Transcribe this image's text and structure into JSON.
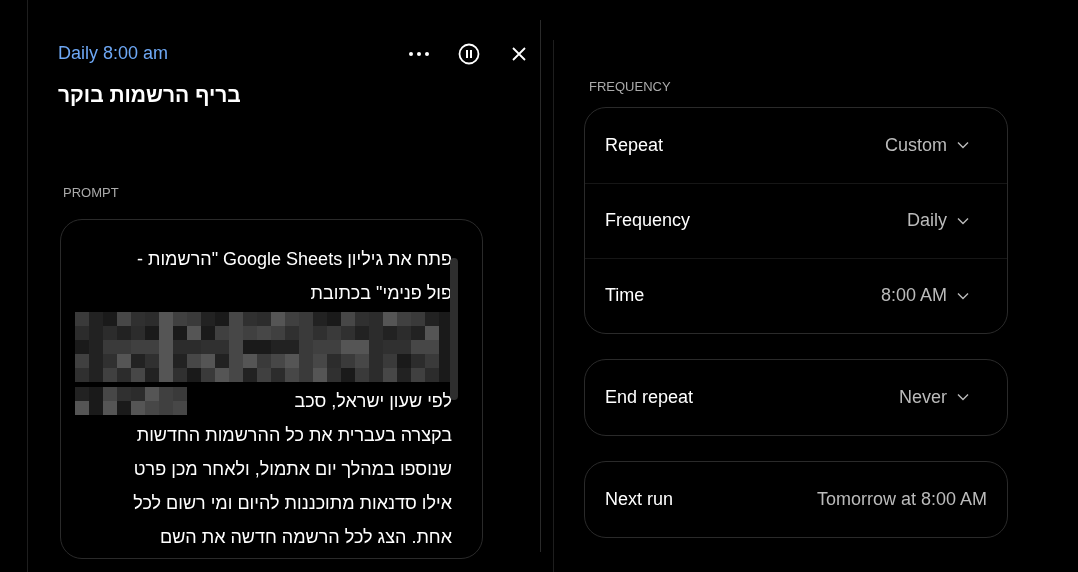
{
  "header": {
    "schedule": "Daily 8:00 am",
    "title": "בריף הרשמות בוקר"
  },
  "prompt": {
    "label": "PROMPT",
    "lines": [
      {
        "kind": "text",
        "text": "פתח את גיליון Google Sheets \"הרשמות -"
      },
      {
        "kind": "text",
        "text": "פול פנימי\" בכתובת"
      },
      {
        "kind": "redacted"
      },
      {
        "kind": "text_redacted",
        "text": "לפי שעון ישראל, סכב"
      },
      {
        "kind": "text",
        "text": "בקצרה בעברית את כל ההרשמות החדשות"
      },
      {
        "kind": "text",
        "text": "שנוספו במהלך יום אתמול, ולאחר מכן פרט"
      },
      {
        "kind": "text",
        "text": "אילו סדנאות מתוכננות להיום ומי רשום לכל"
      },
      {
        "kind": "text",
        "text": "אחת. הצג לכל הרשמה חדשה את השם"
      }
    ]
  },
  "frequency": {
    "label": "FREQUENCY",
    "groups": [
      [
        {
          "label": "Repeat",
          "value": "Custom",
          "kind": "dropdown"
        },
        {
          "label": "Frequency",
          "value": "Daily",
          "kind": "dropdown"
        },
        {
          "label": "Time",
          "value": "8:00 AM",
          "kind": "dropdown"
        }
      ],
      [
        {
          "label": "End repeat",
          "value": "Never",
          "kind": "dropdown"
        }
      ],
      [
        {
          "label": "Next run",
          "value": "Tomorrow at 8:00 AM",
          "kind": "info"
        }
      ]
    ]
  }
}
